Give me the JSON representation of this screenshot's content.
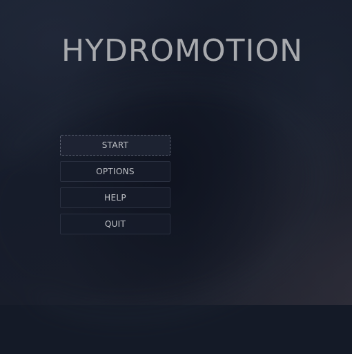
{
  "game": {
    "title": "HYDROMOTION"
  },
  "menu": {
    "items": [
      {
        "label": "START",
        "selected": true
      },
      {
        "label": "OPTIONS",
        "selected": false
      },
      {
        "label": "HELP",
        "selected": false
      },
      {
        "label": "QUIT",
        "selected": false
      }
    ]
  },
  "colors": {
    "background": "#141a27",
    "title_text": "#a8aaae",
    "button_bg": "#171c2a",
    "button_border": "#2a3040",
    "button_text": "#c2c4c8",
    "focus_outline": "#5c6272"
  }
}
